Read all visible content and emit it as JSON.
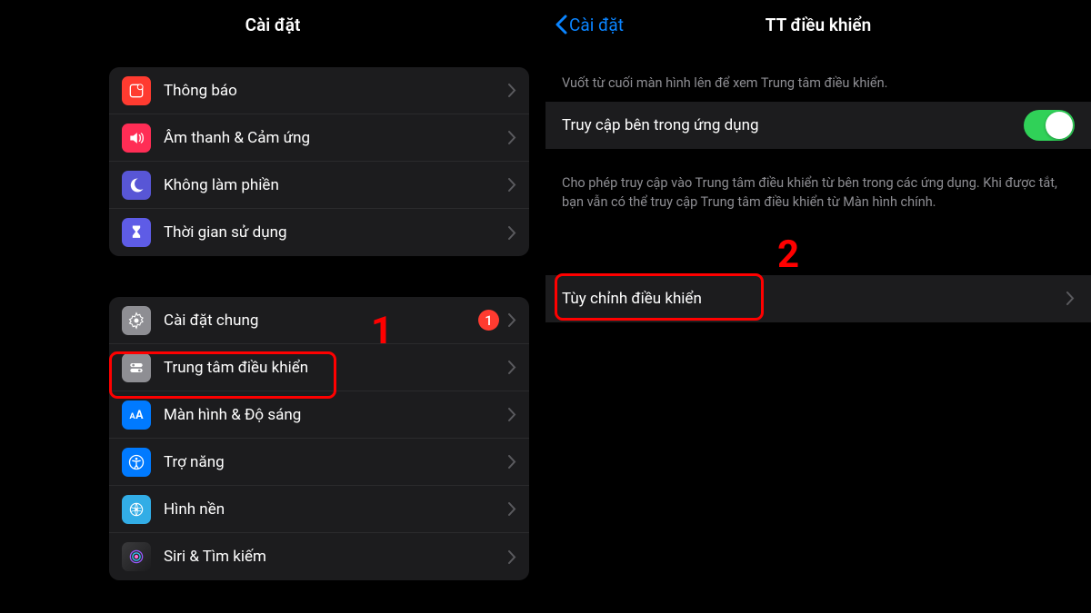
{
  "left": {
    "title": "Cài đặt",
    "group1": [
      {
        "label": "Thông báo"
      },
      {
        "label": "Âm thanh & Cảm ứng"
      },
      {
        "label": "Không làm phiền"
      },
      {
        "label": "Thời gian sử dụng"
      }
    ],
    "group2": [
      {
        "label": "Cài đặt chung",
        "badge": "1"
      },
      {
        "label": "Trung tâm điều khiển"
      },
      {
        "label": "Màn hình & Độ sáng"
      },
      {
        "label": "Trợ năng"
      },
      {
        "label": "Hình nền"
      },
      {
        "label": "Siri & Tìm kiếm"
      }
    ]
  },
  "right": {
    "back": "Cài đặt",
    "title": "TT điều khiển",
    "hint_top": "Vuốt từ cuối màn hình lên để xem Trung tâm điều khiển.",
    "access_label": "Truy cập bên trong ứng dụng",
    "access_hint": "Cho phép truy cập vào Trung tâm điều khiển từ bên trong các ứng dụng. Khi được tắt, bạn vẫn có thể truy cập Trung tâm điều khiển từ Màn hình chính.",
    "customize": "Tùy chỉnh điều khiển"
  },
  "annotations": {
    "step1": "1",
    "step2": "2"
  }
}
